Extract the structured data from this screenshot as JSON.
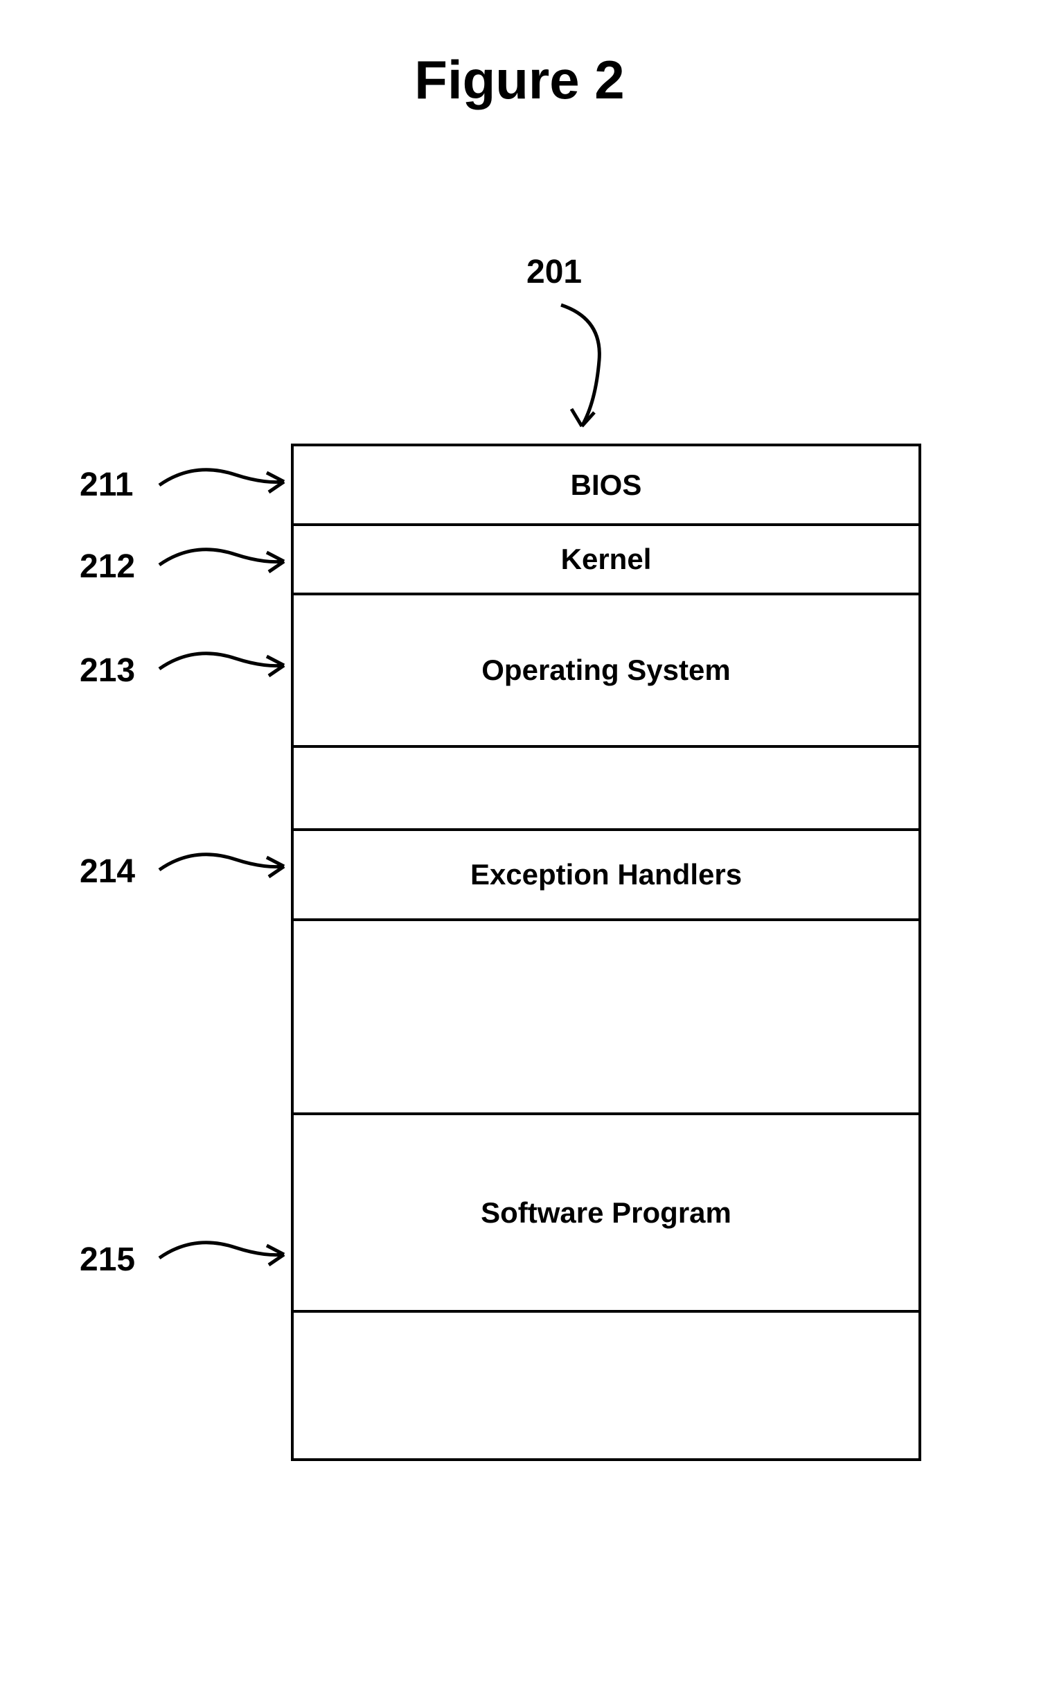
{
  "title": "Figure 2",
  "top_ref": "201",
  "layers": {
    "bios": "BIOS",
    "kernel": "Kernel",
    "os": "Operating System",
    "exception": "Exception Handlers",
    "software": "Software Program"
  },
  "refs": {
    "r211": "211",
    "r212": "212",
    "r213": "213",
    "r214": "214",
    "r215": "215"
  }
}
